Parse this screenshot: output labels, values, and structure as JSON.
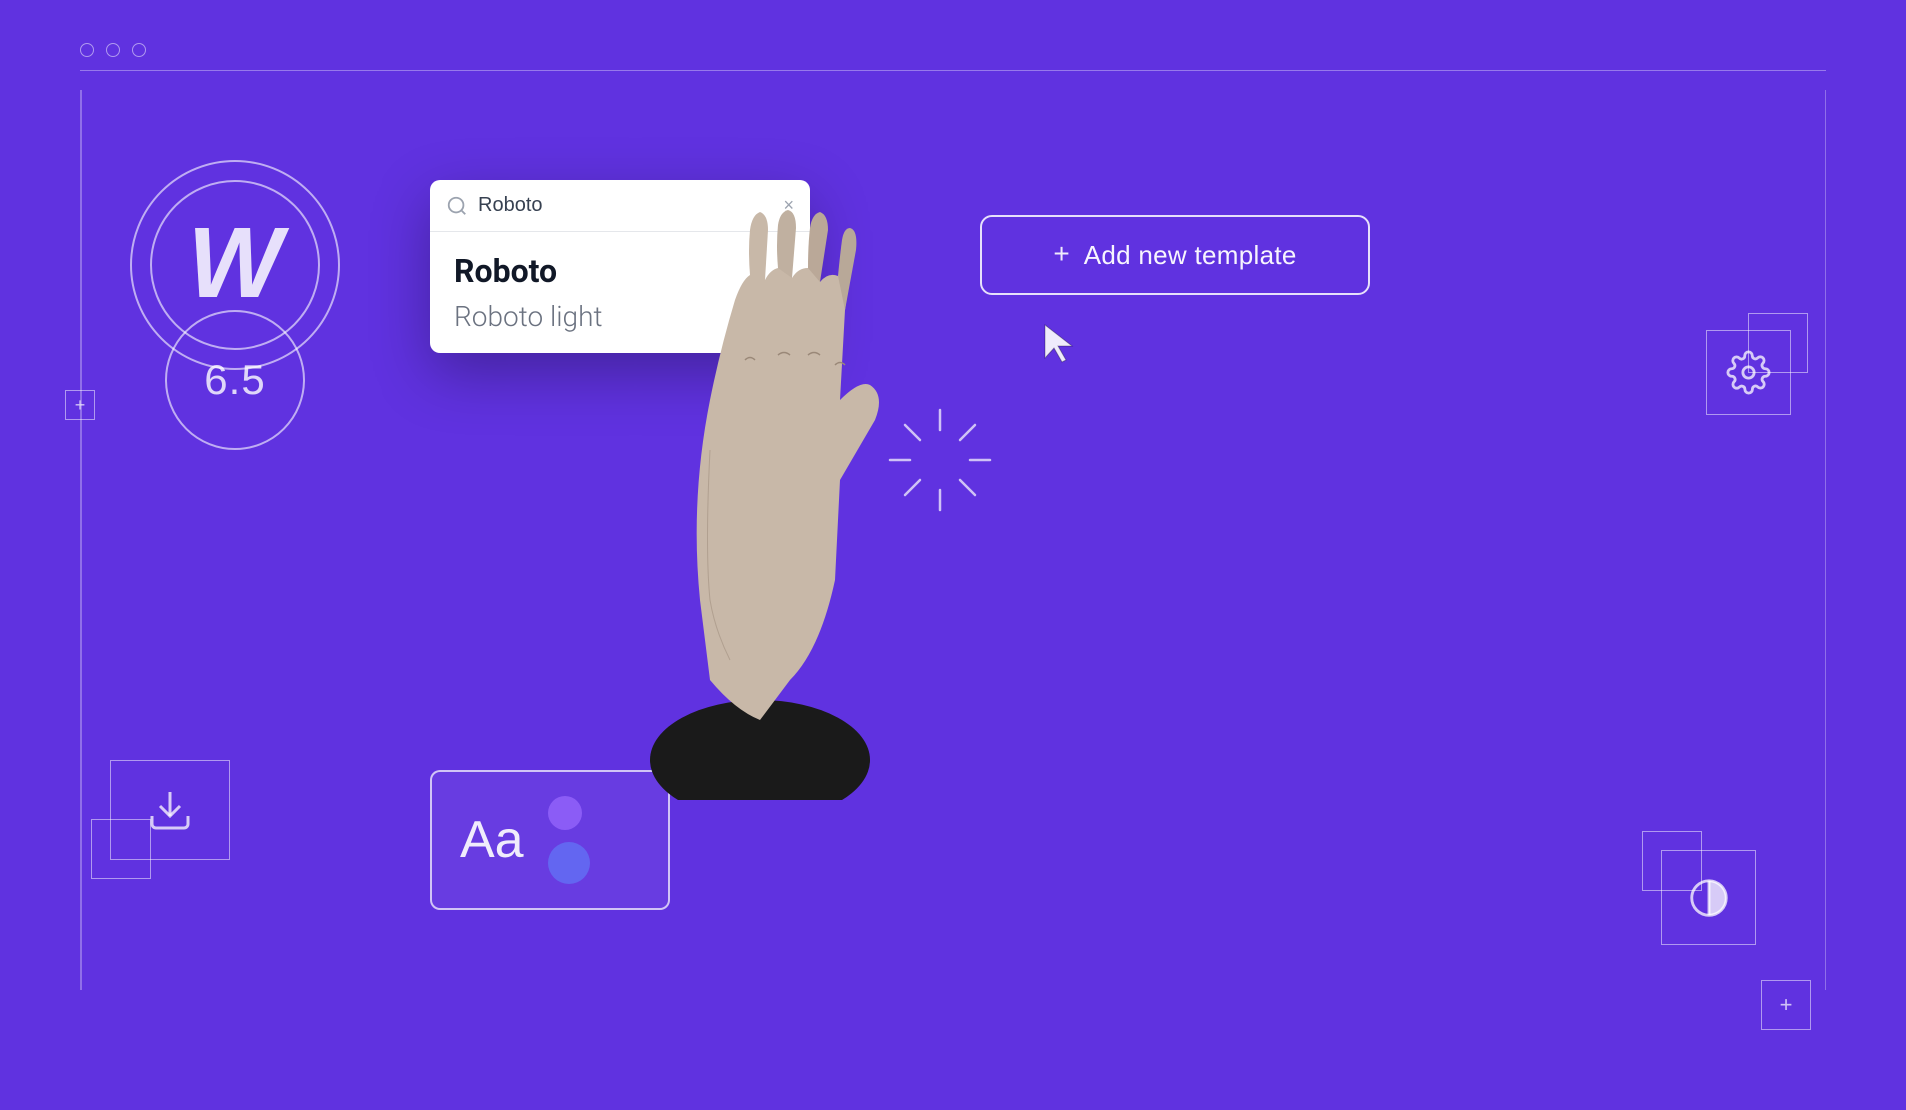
{
  "background": {
    "color": "#6032e0"
  },
  "browser_bar": {
    "dots": [
      "dot1",
      "dot2",
      "dot3"
    ]
  },
  "wp_logo": {
    "letter": "W",
    "version": "6.5"
  },
  "font_search": {
    "search_value": "Roboto",
    "clear_label": "×",
    "results": [
      {
        "name": "Roboto",
        "weight": "bold"
      },
      {
        "name": "Roboto light",
        "weight": "light"
      }
    ]
  },
  "add_template": {
    "plus_label": "+",
    "button_label": "Add new template"
  },
  "aa_panel": {
    "text": "Aa"
  },
  "gear_icon": {
    "label": "settings"
  },
  "download_icon": {
    "label": "download"
  },
  "contrast_icon": {
    "label": "contrast"
  }
}
